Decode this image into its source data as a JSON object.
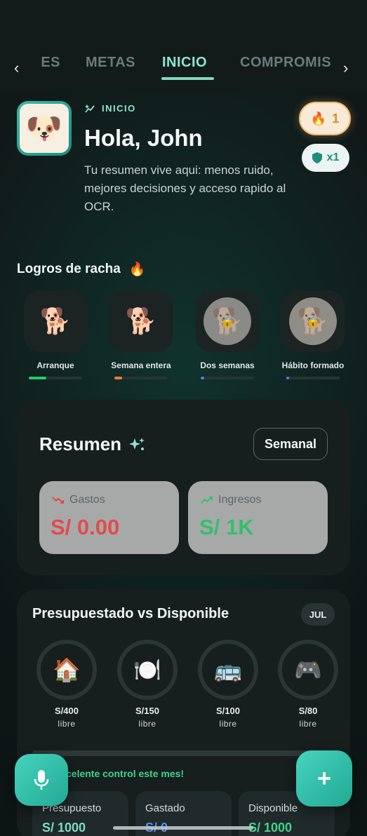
{
  "tabs": {
    "items": [
      "NES",
      "METAS",
      "INICIO",
      "COMPROMIS"
    ],
    "active": "INICIO"
  },
  "header": {
    "kicker": "INICIO",
    "greeting": "Hola, John",
    "subtitle": "Tu resumen vive aqui: menos ruido, mejores decisiones y acceso rapido al OCR.",
    "streak_count": "1",
    "shield_count": "x1"
  },
  "achievements": {
    "title": "Logros de racha",
    "items": [
      {
        "label": "Arranque",
        "progress": 0.33,
        "color": "#2fc46a",
        "locked": false
      },
      {
        "label": "Semana entera",
        "progress": 0.14,
        "color": "#ff7a2e",
        "locked": false
      },
      {
        "label": "Dos semanas",
        "progress": 0.07,
        "color": "#4e7bf2",
        "locked": true
      },
      {
        "label": "Hábito formado",
        "progress": 0.05,
        "color": "#8a63e8",
        "locked": true
      }
    ]
  },
  "summary": {
    "title": "Resumen",
    "period": "Semanal",
    "expenses_label": "Gastos",
    "expenses_value": "S/ 0.00",
    "income_label": "Ingresos",
    "income_value": "S/ 1K",
    "colors": {
      "expenses": "#e24b4b",
      "income": "#33c06a"
    }
  },
  "budget": {
    "title": "Presupuestado vs Disponible",
    "month": "JUL",
    "categories": [
      {
        "icon": "house-icon",
        "glyph": "🏠",
        "amount": "S/400",
        "sub": "libre"
      },
      {
        "icon": "plate-icon",
        "glyph": "🍽️",
        "amount": "S/150",
        "sub": "libre"
      },
      {
        "icon": "bus-icon",
        "glyph": "🚌",
        "amount": "S/100",
        "sub": "libre"
      },
      {
        "icon": "gamepad-icon",
        "glyph": "🎮",
        "amount": "S/80",
        "sub": "libre"
      }
    ],
    "message": "celente control este mes!",
    "stats": [
      {
        "label": "Presupuesto",
        "value": "S/ 1000",
        "color": "#7fd9c5"
      },
      {
        "label": "Gastado",
        "value": "S/ 0",
        "color": "#4e8ef2"
      },
      {
        "label": "Disponible",
        "value": "S/ 1000",
        "color": "#42d38b"
      }
    ]
  },
  "actions": {
    "add_label": "+"
  }
}
